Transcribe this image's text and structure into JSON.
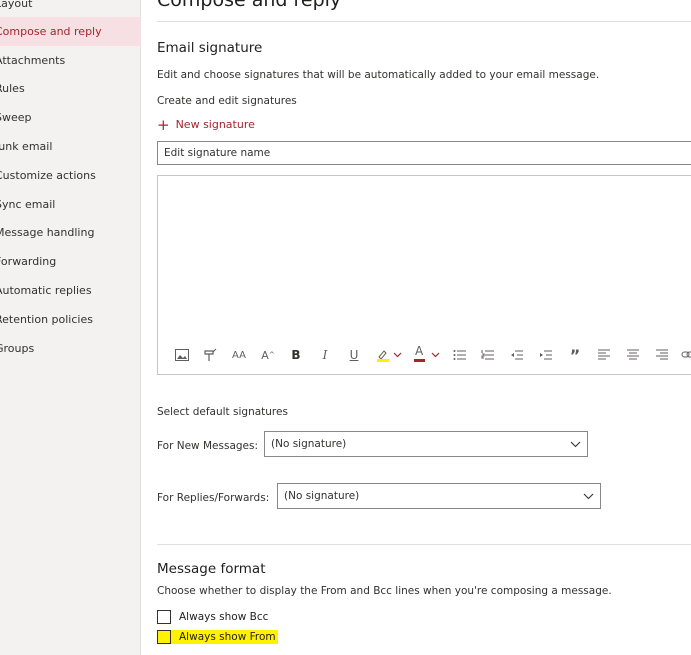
{
  "sidebar": {
    "items": [
      {
        "label": "Layout",
        "selected": false
      },
      {
        "label": "Compose and reply",
        "selected": true
      },
      {
        "label": "Attachments",
        "selected": false
      },
      {
        "label": "Rules",
        "selected": false
      },
      {
        "label": "Sweep",
        "selected": false
      },
      {
        "label": "Junk email",
        "selected": false
      },
      {
        "label": "Customize actions",
        "selected": false
      },
      {
        "label": "Sync email",
        "selected": false
      },
      {
        "label": "Message handling",
        "selected": false
      },
      {
        "label": "Forwarding",
        "selected": false
      },
      {
        "label": "Automatic replies",
        "selected": false
      },
      {
        "label": "Retention policies",
        "selected": false
      },
      {
        "label": "Groups",
        "selected": false
      }
    ]
  },
  "main": {
    "title": "Compose and reply",
    "signature": {
      "heading": "Email signature",
      "description": "Edit and choose signatures that will be automatically added to your email message.",
      "create_label": "Create and edit signatures",
      "new_signature_label": "New signature",
      "name_placeholder": "Edit signature name",
      "toolbar_icons": [
        "insert-picture-icon",
        "format-painter-icon",
        "font-size-icon",
        "grow-font-icon",
        "bold-icon",
        "italic-icon",
        "underline-icon",
        "highlight-icon",
        "font-color-icon",
        "bullets-icon",
        "numbering-icon",
        "decrease-indent-icon",
        "increase-indent-icon",
        "quote-icon",
        "align-left-icon",
        "align-center-icon",
        "align-right-icon",
        "insert-link-icon"
      ],
      "toolbar_text": {
        "bold": "B",
        "italic": "I",
        "underline": "U",
        "font_color": "A",
        "font_size": "AA",
        "grow_font": "A",
        "quote": "”"
      }
    },
    "defaults": {
      "heading": "Select default signatures",
      "new_messages_label": "For New Messages:",
      "new_messages_value": "(No signature)",
      "replies_label": "For Replies/Forwards:",
      "replies_value": "(No signature)"
    },
    "message_format": {
      "heading": "Message format",
      "description": "Choose whether to display the From and Bcc lines when you're composing a message.",
      "always_show_bcc": "Always show Bcc",
      "always_show_from": "Always show From",
      "highlight_color": "#fff200"
    }
  },
  "colors": {
    "accent": "#a4262c",
    "selected_bg": "#f7e0e3",
    "sidebar_bg": "#f3f2f1"
  }
}
